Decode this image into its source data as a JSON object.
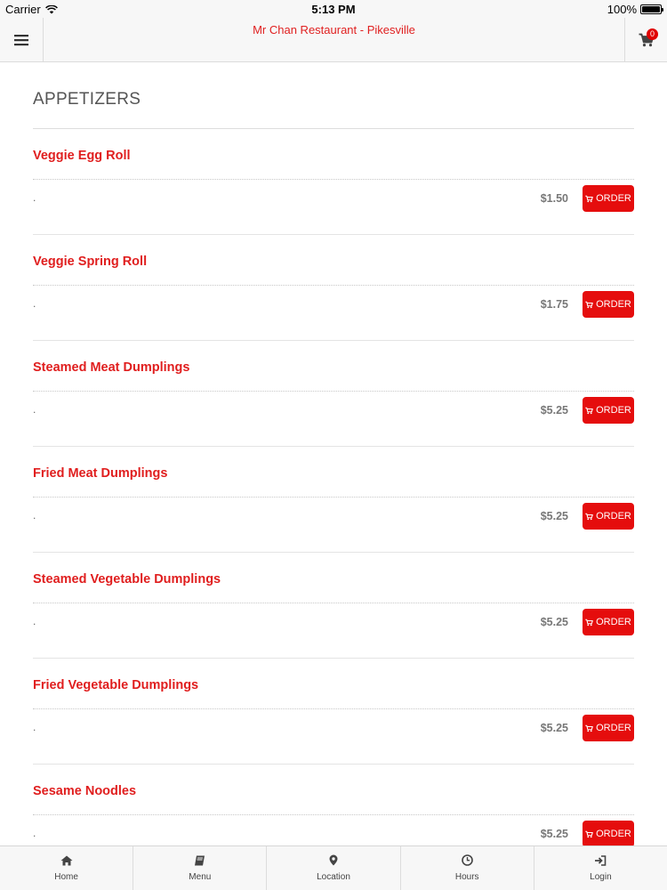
{
  "status": {
    "carrier": "Carrier",
    "time": "5:13 PM",
    "battery": "100%",
    "battery_level": 1.0
  },
  "header": {
    "title": "Mr Chan Restaurant - Pikesville",
    "cart_count": "0"
  },
  "section": {
    "title": "APPETIZERS"
  },
  "order_label": "ORDER",
  "items": [
    {
      "name": "Veggie Egg Roll",
      "description": ".",
      "price": "$1.50"
    },
    {
      "name": "Veggie Spring Roll",
      "description": ".",
      "price": "$1.75"
    },
    {
      "name": "Steamed Meat Dumplings",
      "description": ".",
      "price": "$5.25"
    },
    {
      "name": "Fried Meat Dumplings",
      "description": ".",
      "price": "$5.25"
    },
    {
      "name": "Steamed Vegetable Dumplings",
      "description": ".",
      "price": "$5.25"
    },
    {
      "name": "Fried Vegetable Dumplings",
      "description": ".",
      "price": "$5.25"
    },
    {
      "name": "Sesame Noodles",
      "description": ".",
      "price": "$5.25"
    }
  ],
  "nav": [
    {
      "label": "Home",
      "icon": "home-icon"
    },
    {
      "label": "Menu",
      "icon": "book-icon"
    },
    {
      "label": "Location",
      "icon": "map-pin-icon"
    },
    {
      "label": "Hours",
      "icon": "clock-icon"
    },
    {
      "label": "Login",
      "icon": "sign-in-icon"
    }
  ],
  "colors": {
    "accent": "#e50d0d",
    "title_red": "#e01e1e"
  }
}
